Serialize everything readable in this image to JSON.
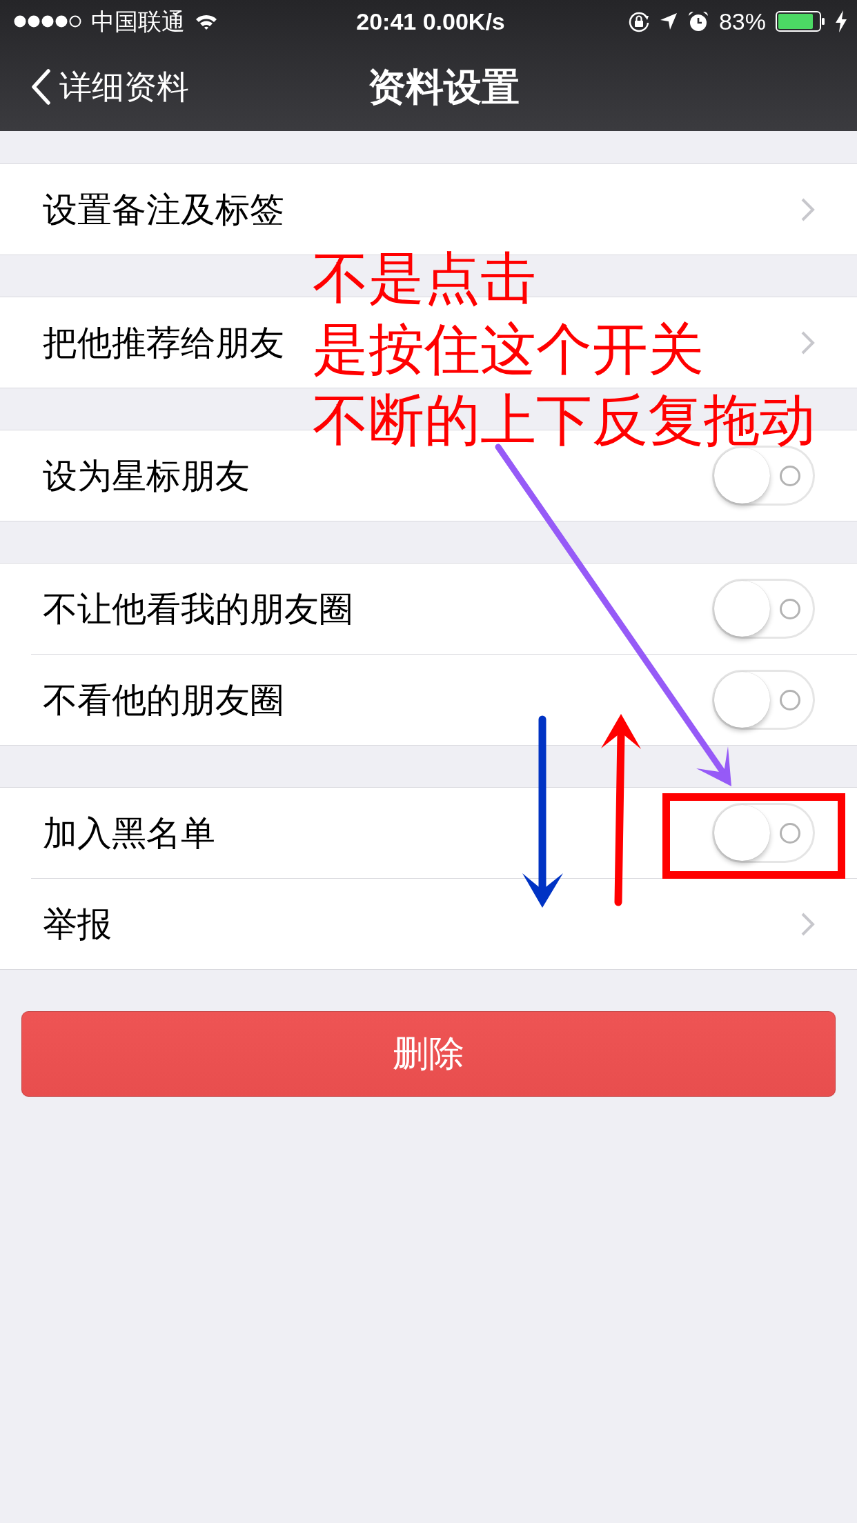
{
  "status_bar": {
    "carrier": "中国联通",
    "time": "20:41 0.00K/s",
    "battery": "83%"
  },
  "nav_bar": {
    "back": "详细资料",
    "title": "资料设置"
  },
  "groups": [
    {
      "rows": [
        {
          "kind": "link",
          "label": "设置备注及标签"
        }
      ]
    },
    {
      "rows": [
        {
          "kind": "link",
          "label": "把他推荐给朋友"
        }
      ]
    },
    {
      "rows": [
        {
          "kind": "toggle",
          "label": "设为星标朋友",
          "on": false
        }
      ]
    },
    {
      "rows": [
        {
          "kind": "toggle",
          "label": "不让他看我的朋友圈",
          "on": false
        },
        {
          "kind": "toggle",
          "label": "不看他的朋友圈",
          "on": false
        }
      ]
    },
    {
      "rows": [
        {
          "kind": "toggle",
          "label": "加入黑名单",
          "on": false
        },
        {
          "kind": "link",
          "label": "举报"
        }
      ]
    }
  ],
  "delete_button": {
    "label": "删除"
  },
  "annotation": {
    "lines": [
      "不是点击",
      "是按住这个开关",
      "不断的上下反复拖动"
    ]
  }
}
